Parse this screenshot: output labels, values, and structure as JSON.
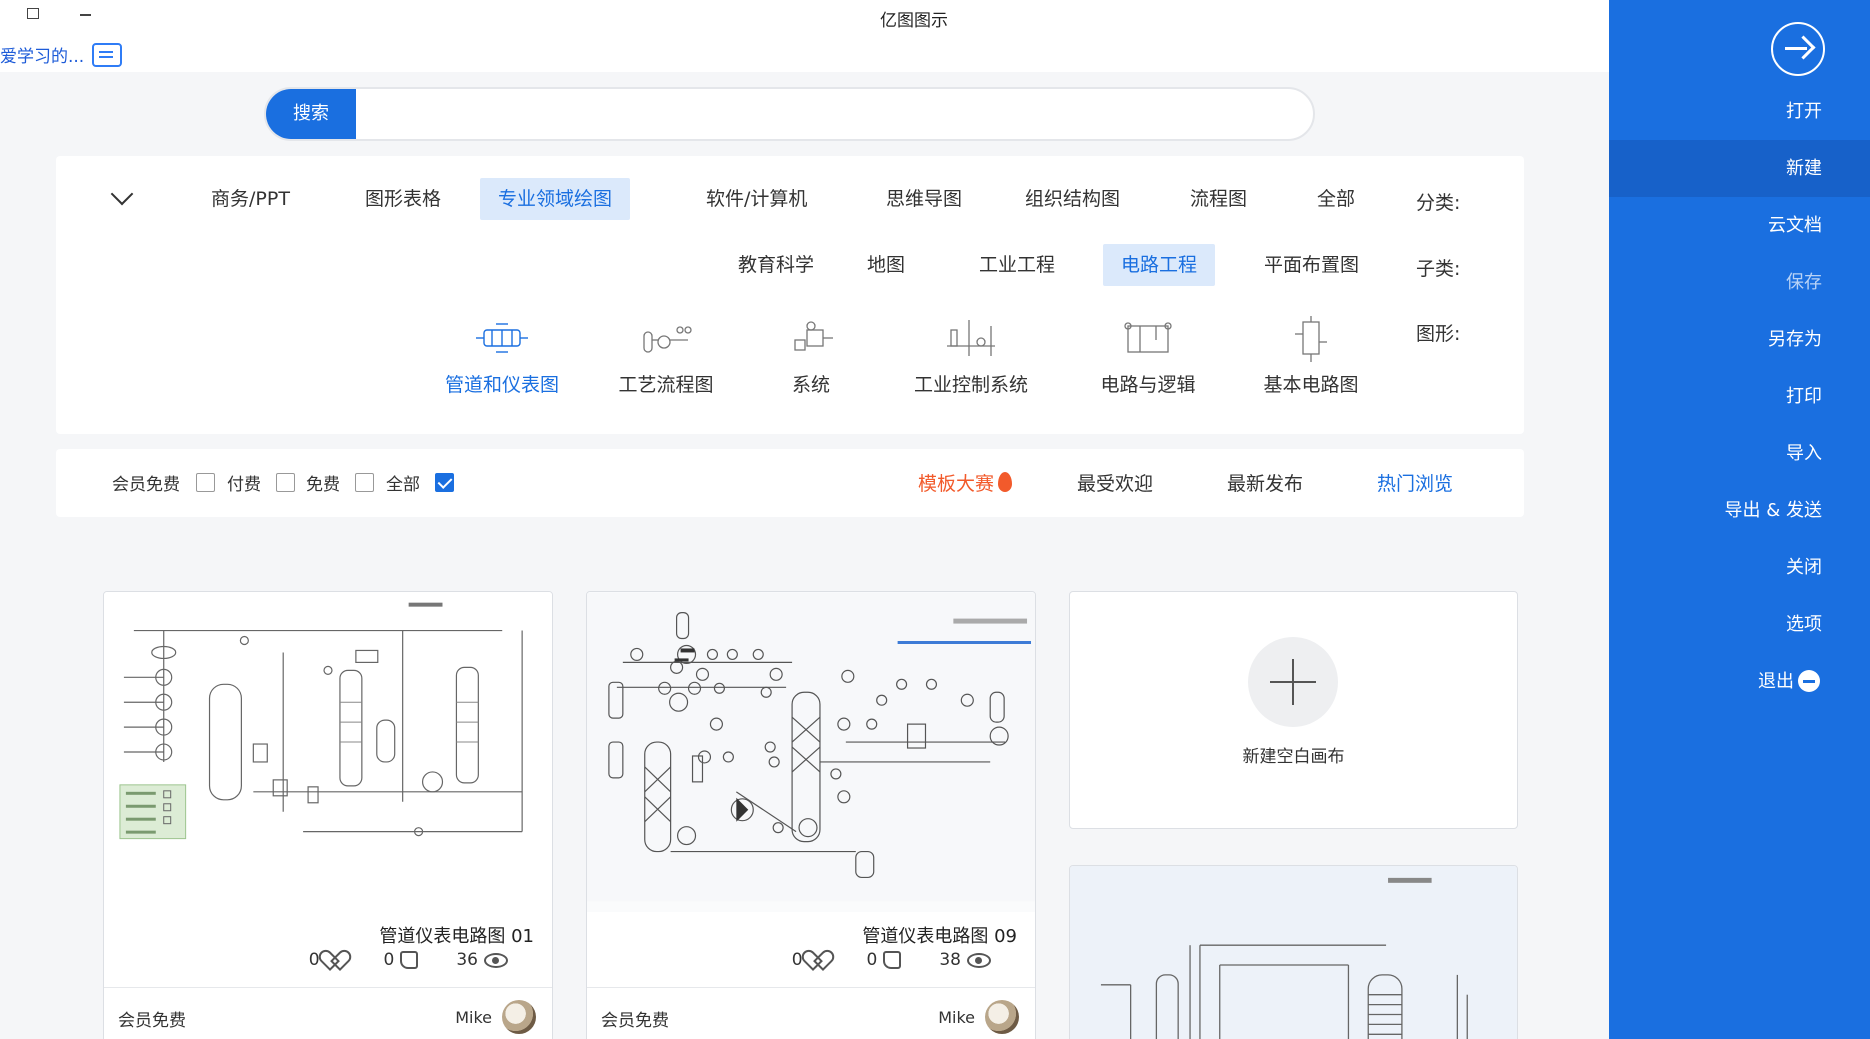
{
  "window": {
    "title": "亿图图示",
    "feedback_label": "爱学习的..."
  },
  "sidebar": {
    "items": [
      {
        "label": "打开"
      },
      {
        "label": "新建"
      },
      {
        "label": "云文档"
      },
      {
        "label": "保存"
      },
      {
        "label": "另存为"
      },
      {
        "label": "打印"
      },
      {
        "label": "导入"
      },
      {
        "label": "导出 & 发送"
      },
      {
        "label": "关闭"
      },
      {
        "label": "选项"
      },
      {
        "label": "退出"
      }
    ]
  },
  "search": {
    "button_label": "搜索",
    "placeholder": ""
  },
  "filters": {
    "category_label": "分类:",
    "categories": [
      "全部",
      "流程图",
      "组织结构图",
      "思维导图",
      "软件/计算机",
      "专业领域绘图",
      "图形表格",
      "商务/PPT"
    ],
    "subcategory_label": "子类:",
    "subcategories": [
      "平面布置图",
      "电路工程",
      "工业工程",
      "地图",
      "教育科学"
    ],
    "shape_label": "图形:",
    "shapes": [
      "基本电路图",
      "电路与逻辑",
      "工业控制系统",
      "系统",
      "工艺流程图",
      "管道和仪表图"
    ]
  },
  "sortbar": {
    "tabs": [
      "热门浏览",
      "最新发布",
      "最受欢迎",
      "模板大赛"
    ],
    "checkboxes": [
      "全部",
      "免费",
      "付费",
      "会员免费"
    ]
  },
  "cards": [
    {
      "name": "管道仪表电路图 01",
      "views": "36",
      "likes": "0",
      "favorites": "0",
      "author": "Mike",
      "price": "会员免费"
    },
    {
      "name": "管道仪表电路图 09",
      "views": "38",
      "likes": "0",
      "favorites": "0",
      "author": "Mike",
      "price": "会员免费"
    }
  ],
  "new_canvas": {
    "label": "新建空白画布"
  },
  "colors": {
    "accent": "#1a6fe0",
    "sidebar_active": "#1761c9",
    "chip_selected_bg": "#dbe9fb",
    "contest": "#f25a2b"
  }
}
